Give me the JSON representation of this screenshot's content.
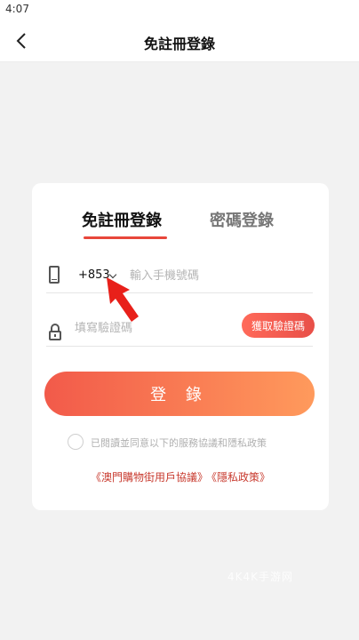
{
  "statusbar": {
    "time": "4:07"
  },
  "header": {
    "title": "免註冊登錄"
  },
  "tabs": [
    {
      "label": "免註冊登錄",
      "active": true
    },
    {
      "label": "密碼登錄",
      "active": false
    }
  ],
  "phone": {
    "country_code": "+853",
    "placeholder": "輸入手機號碼",
    "value": ""
  },
  "code": {
    "placeholder": "填寫驗證碼",
    "value": "",
    "button_label": "獲取驗證碼"
  },
  "login": {
    "label": "登 錄"
  },
  "agreement": {
    "checked": false,
    "text": "已閱讀並同意以下的服務協議和隱私政策",
    "links": [
      "《澳門購物街用戶協議》",
      "《隱私政策》"
    ]
  },
  "watermark": {
    "text": "4K4K手游网"
  },
  "colors": {
    "accent": "#e8463b",
    "gradient_start": "#f25a4a",
    "gradient_end": "#ff9a5c",
    "link": "#c83a2e"
  },
  "icons": [
    "back-icon",
    "phone-icon",
    "chevron-down-icon",
    "lock-icon",
    "arrow-annotation-icon"
  ]
}
